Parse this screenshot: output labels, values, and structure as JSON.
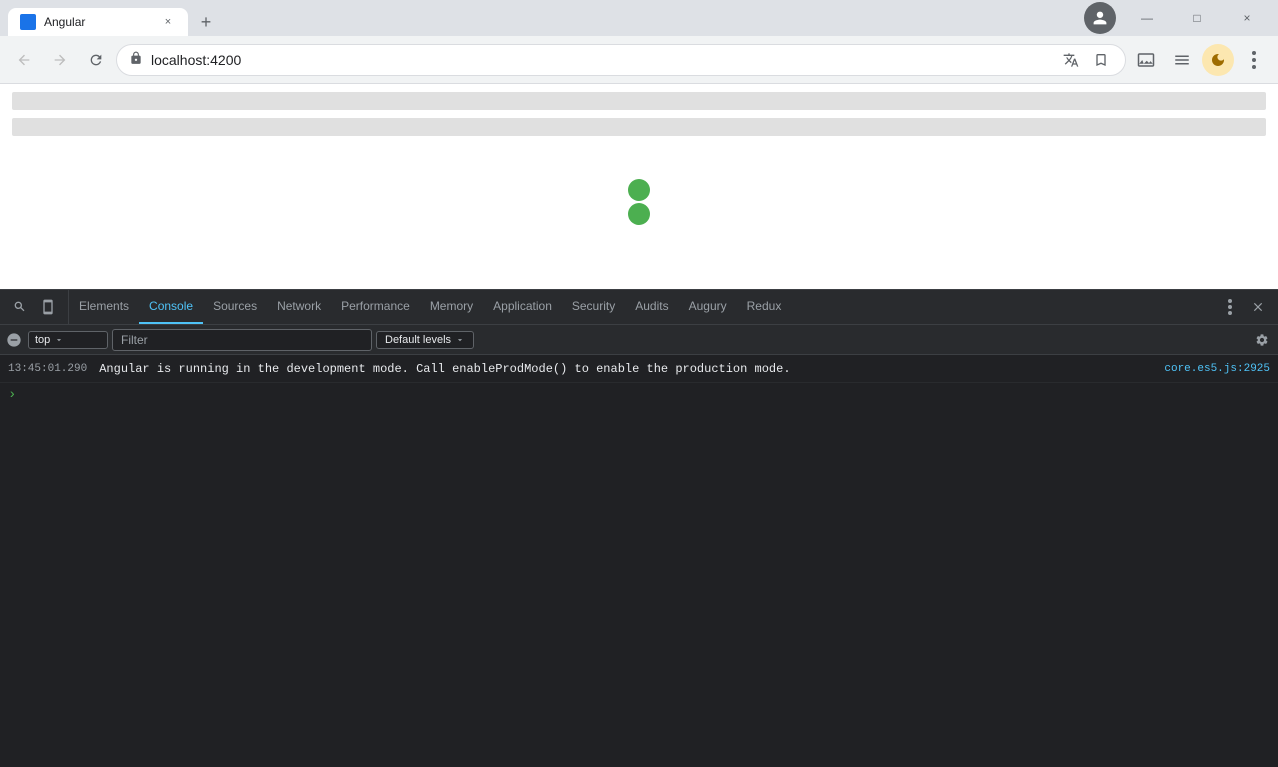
{
  "window": {
    "title": "Angular",
    "url": "localhost:4200",
    "tab_close": "×",
    "new_tab": "+"
  },
  "window_controls": {
    "minimize": "—",
    "maximize": "□",
    "close": "×"
  },
  "nav": {
    "back": "←",
    "forward": "→",
    "reload": "↻",
    "lock_icon": "🔒",
    "profile_icon": "👤"
  },
  "url_bar": {
    "url": "localhost:4200",
    "bookmark_icon": "☆",
    "screenshot_icon": "⊡",
    "reader_icon": "☰",
    "moon_icon": "☾",
    "more_icon": "⋮",
    "translate_icon": "⊕"
  },
  "devtools": {
    "tabs": [
      {
        "label": "Elements",
        "active": false
      },
      {
        "label": "Console",
        "active": true
      },
      {
        "label": "Sources",
        "active": false
      },
      {
        "label": "Network",
        "active": false
      },
      {
        "label": "Performance",
        "active": false
      },
      {
        "label": "Memory",
        "active": false
      },
      {
        "label": "Application",
        "active": false
      },
      {
        "label": "Security",
        "active": false
      },
      {
        "label": "Audits",
        "active": false
      },
      {
        "label": "Augury",
        "active": false
      },
      {
        "label": "Redux",
        "active": false
      }
    ],
    "toolbar": {
      "context": "top",
      "filter_placeholder": "Filter",
      "levels": "Default levels"
    },
    "console": {
      "messages": [
        {
          "timestamp": "13:45:01.290",
          "text": "Angular is running in the development mode. Call enableProdMode() to enable the production mode.",
          "source": "core.es5.js:2925"
        }
      ]
    },
    "icons": {
      "inspect": "⊡",
      "device": "⊟",
      "ban": "⊘",
      "more": "⋮",
      "close": "×",
      "gear": "⚙"
    }
  },
  "page": {
    "loading_bars": 2,
    "angular_circles": 2,
    "circle_color": "#4caf50"
  }
}
